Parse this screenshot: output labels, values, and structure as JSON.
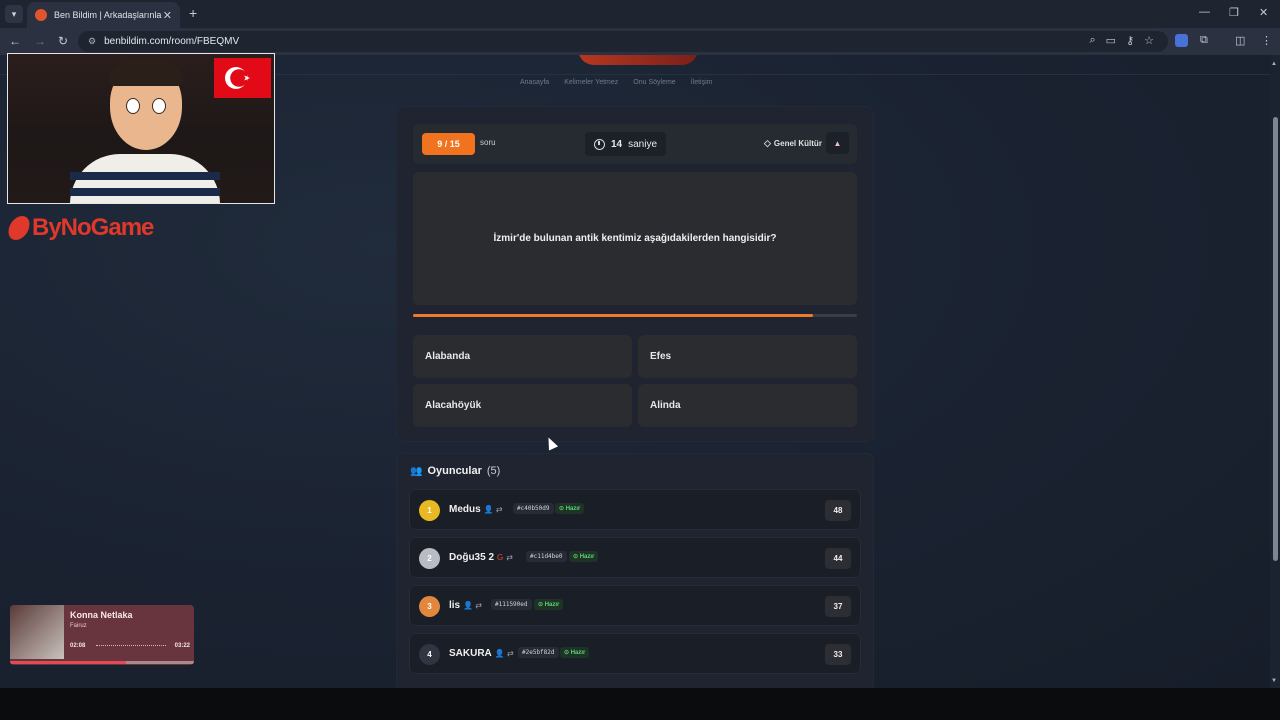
{
  "browser": {
    "tab_title": "Ben Bildim | Arkadaşlarınla Online",
    "url": "benbildim.com/room/FBEQMV",
    "new_tab_symbol": "+",
    "tab_close_symbol": "✕"
  },
  "site": {
    "nav": [
      "Anasayfa",
      "Kelimeler Yetmez",
      "Onu Söyleme",
      "İletişim"
    ]
  },
  "game": {
    "question_counter": "9 / 15",
    "question_label": "soru",
    "timer_value": "14",
    "timer_unit": "saniye",
    "category": "Genel Kültür",
    "question": "İzmir'de bulunan antik kentimiz aşağıdakilerden hangisidir?",
    "time_progress": 0.9,
    "options": [
      "Alabanda",
      "Efes",
      "Alacahöyük",
      "Alinda"
    ]
  },
  "players": {
    "title": "Oyuncular",
    "count": "(5)",
    "list": [
      {
        "rank": "1",
        "name": "Medus",
        "hash": "#c40b50d9",
        "status": "Hazır",
        "score": "48",
        "rank_color": "#e8b923",
        "login_icon": "user-icon"
      },
      {
        "rank": "2",
        "name": "Doğu35 2",
        "hash": "#c11d4be0",
        "status": "Hazır",
        "score": "44",
        "rank_color": "#b9bcc2",
        "login_icon": "google-icon"
      },
      {
        "rank": "3",
        "name": "lis",
        "hash": "#111590ed",
        "status": "Hazır",
        "score": "37",
        "rank_color": "#e2873d",
        "login_icon": "user-icon"
      },
      {
        "rank": "4",
        "name": "SAKURA",
        "hash": "#2e5bf82d",
        "status": "Hazır",
        "score": "33",
        "rank_color": "#2f3541",
        "login_icon": "user-icon"
      }
    ]
  },
  "overlay": {
    "brand": "ByNoGame",
    "music": {
      "song": "Konna Netlaka",
      "artist": "Fairuz",
      "elapsed": "02:08",
      "total": "03:22",
      "progress": 0.63
    }
  },
  "colors": {
    "accent": "#f2731f",
    "ready": "#5ad37a",
    "brand_red": "#e0382a"
  }
}
